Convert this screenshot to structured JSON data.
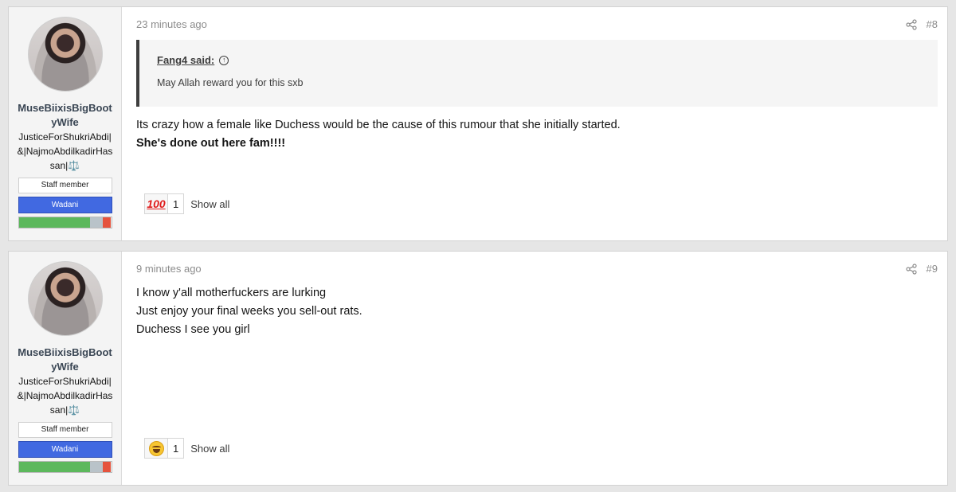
{
  "posts": [
    {
      "author": "MuseBiixisBigBootyWife",
      "user_title": "JusticeForShukriAbdi|&|NajmoAbdilkadirHassan|⚖️",
      "staff_label": "Staff member",
      "group_label": "Wadani",
      "group_color": "#4169e1",
      "reputation": {
        "green": 0.77,
        "gray": 0.14,
        "red": 0.09
      },
      "date": "23 minutes ago",
      "post_number": "#8",
      "quote": {
        "author_label": "Fang4 said:",
        "text": "May Allah reward you for this sxb"
      },
      "body_lines": [
        "Its crazy how a female like Duchess would be the cause of this rumour that she initially started."
      ],
      "body_bold_line": "She's done out here fam!!!!",
      "reaction": {
        "emoji": "hundred-points-icon",
        "count": "1",
        "show_all": "Show all"
      }
    },
    {
      "author": "MuseBiixisBigBootyWife",
      "user_title": "JusticeForShukriAbdi|&|NajmoAbdilkadirHassan|⚖️",
      "staff_label": "Staff member",
      "group_label": "Wadani",
      "group_color": "#4169e1",
      "reputation": {
        "green": 0.77,
        "gray": 0.14,
        "red": 0.09
      },
      "date": "9 minutes ago",
      "post_number": "#9",
      "body_lines": [
        "I know y'all motherfuckers are lurking",
        "Just enjoy your final weeks you sell-out rats.",
        "Duchess I see you girl"
      ],
      "reaction": {
        "emoji": "laughing-face-icon",
        "count": "1",
        "show_all": "Show all"
      }
    }
  ],
  "colors": {
    "rep_green": "#5cb85c",
    "rep_gray": "#b9c3c9",
    "rep_red": "#e5533d",
    "quote_border": "#3e3e3e"
  }
}
